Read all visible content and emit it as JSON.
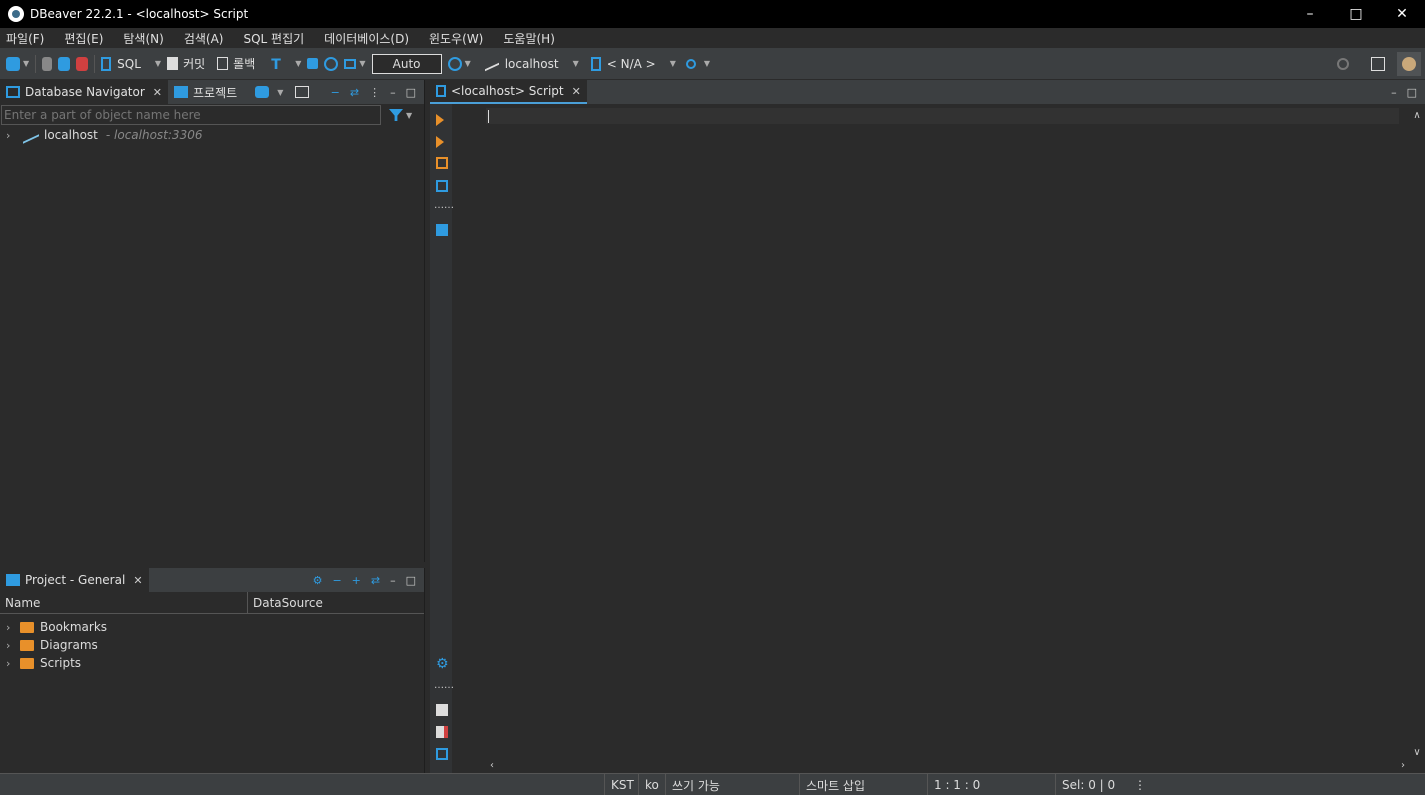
{
  "window": {
    "title": "DBeaver 22.2.1 - <localhost> Script"
  },
  "menu": [
    "파일(F)",
    "편집(E)",
    "탐색(N)",
    "검색(A)",
    "SQL 편집기",
    "데이터베이스(D)",
    "윈도우(W)",
    "도움말(H)"
  ],
  "toolbar": {
    "sql_label": "SQL",
    "commit_label": "커밋",
    "rollback_label": "롤백",
    "transaction_mode": "Auto",
    "datasource": "localhost",
    "schema": "< N/A >"
  },
  "navigator": {
    "tab_label": "Database Navigator",
    "projects_tab_label": "프로젝트",
    "filter_placeholder": "Enter a part of object name here",
    "connections": [
      {
        "name": "localhost",
        "detail": "- localhost:3306"
      }
    ]
  },
  "project": {
    "tab_label": "Project - General",
    "columns": [
      "Name",
      "DataSource"
    ],
    "items": [
      "Bookmarks",
      "Diagrams",
      "Scripts"
    ]
  },
  "editor": {
    "tab_label": "<localhost> Script",
    "content": ""
  },
  "status": {
    "timezone": "KST",
    "locale": "ko",
    "writable": "쓰기 가능",
    "insert_mode": "스마트 삽입",
    "position": "1 : 1 : 0",
    "selection": "Sel: 0 | 0"
  },
  "colors": {
    "accent": "#4a9fd8",
    "orange": "#e8902a",
    "background": "#2b2b2b",
    "panel": "#3c3f41"
  }
}
